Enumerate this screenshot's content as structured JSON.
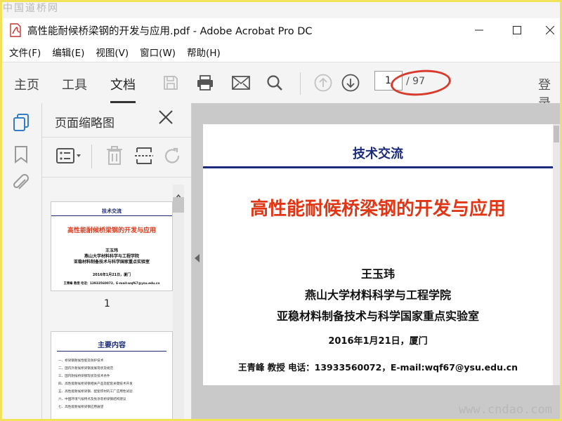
{
  "watermarks": {
    "top_left": "中国道桥网",
    "bottom_right": "www.cndao.com"
  },
  "window": {
    "title": "高性能耐候桥梁钢的开发与应用.pdf - Adobe Acrobat Pro DC",
    "minimize": "—",
    "maximize": "☐"
  },
  "menu": [
    "文件(F)",
    "编辑(E)",
    "视图(V)",
    "窗口(W)",
    "帮助(H)"
  ],
  "toolbar": {
    "tabs": [
      "主页",
      "工具",
      "文档"
    ],
    "active_tab": "文档",
    "page_current": "1",
    "page_total": "/ 97",
    "login": "登录"
  },
  "panel": {
    "title": "页面缩略图",
    "thumb1_number": "1",
    "thumb1": {
      "section": "技术交流",
      "title": "高性能耐候桥梁钢的开发与应用",
      "l1": "王玉玮",
      "l2": "燕山大学材料科学与工程学院",
      "l3": "亚稳材料制备技术与科学国家重点实验室",
      "l4": "2016年1月21日，厦门",
      "l5": "王青峰 教授 电话：13933560072，E-mail:wqf67@ysu.edu.cn"
    },
    "thumb2": {
      "title": "主要内容",
      "items": [
        "一、桥梁钢耐候性能及防护技术",
        "二、国内外耐候桥梁钢发展现状及规范",
        "三、国内耐候桥梁钢现状及技术条件",
        "四、高性能耐候桥梁钢相关产品及配套关键技术开发",
        "五、高性能耐候桥梁钢、配套焊材的工厂应用性试验",
        "六、中国环境气候特点及免涂装桥梁钢结构建议",
        "七、高性能耐候桥梁钢应用展望"
      ]
    }
  },
  "document": {
    "section": "技术交流",
    "title": "高性能耐候桥梁钢的开发与应用",
    "author": "王玉玮",
    "org1": "燕山大学材料科学与工程学院",
    "org2": "亚稳材料制备技术与科学国家重点实验室",
    "date": "2016年1月21日，厦门",
    "contact": "王青峰 教授 电话：13933560072，E-mail:wqf67@ysu.edu.cn"
  },
  "colors": {
    "accent_blue": "#1b2a7a",
    "title_red": "#e03616",
    "highlight": "#d93a2b",
    "frame": "#f2e25a"
  },
  "icons": [
    "pdf-file-icon",
    "save-icon",
    "print-icon",
    "mail-icon",
    "search-icon",
    "page-up-icon",
    "page-down-icon",
    "thumbnails-icon",
    "bookmark-icon",
    "attachment-icon",
    "close-icon",
    "options-icon",
    "delete-icon",
    "crop-icon",
    "rotate-icon",
    "collapse-arrow-icon"
  ]
}
